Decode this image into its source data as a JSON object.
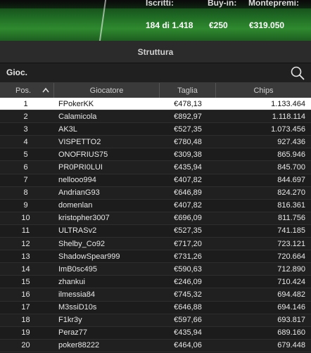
{
  "stats": {
    "iscritti_label": "Iscritti:",
    "buyin_label": "Buy-in:",
    "montepremi_label": "Montepremi:",
    "iscritti_value": "184 di 1.418",
    "buyin_value": "€250",
    "montepremi_value": "€319.050"
  },
  "section_title": "Struttura",
  "search": {
    "label": "Gioc.",
    "icon": "search-icon"
  },
  "table": {
    "columns": [
      "Pos.",
      "Giocatore",
      "Taglia",
      "Chips"
    ],
    "sort_icon": "chevron-up-icon",
    "rows": [
      {
        "pos": "1",
        "name": "FPokerKK",
        "taglia": "€478,13",
        "chips": "1.133.464"
      },
      {
        "pos": "2",
        "name": "Calamicola",
        "taglia": "€892,97",
        "chips": "1.118.114"
      },
      {
        "pos": "3",
        "name": "AK3L",
        "taglia": "€527,35",
        "chips": "1.073.456"
      },
      {
        "pos": "4",
        "name": "VISPETTO2",
        "taglia": "€780,48",
        "chips": "927.436"
      },
      {
        "pos": "5",
        "name": "ONOFRIUS75",
        "taglia": "€309,38",
        "chips": "865.946"
      },
      {
        "pos": "6",
        "name": "PR0PRI0LUI",
        "taglia": "€435,94",
        "chips": "845.700"
      },
      {
        "pos": "7",
        "name": "nellooo994",
        "taglia": "€407,82",
        "chips": "844.697"
      },
      {
        "pos": "8",
        "name": "AndrianG93",
        "taglia": "€646,89",
        "chips": "824.270"
      },
      {
        "pos": "9",
        "name": "domenlan",
        "taglia": "€407,82",
        "chips": "816.361"
      },
      {
        "pos": "10",
        "name": "kristopher3007",
        "taglia": "€696,09",
        "chips": "811.756"
      },
      {
        "pos": "11",
        "name": "ULTRASv2",
        "taglia": "€527,35",
        "chips": "741.185"
      },
      {
        "pos": "12",
        "name": "Shelby_Co92",
        "taglia": "€717,20",
        "chips": "723.121"
      },
      {
        "pos": "13",
        "name": "ShadowSpear999",
        "taglia": "€731,26",
        "chips": "720.664"
      },
      {
        "pos": "14",
        "name": "ImB0sc495",
        "taglia": "€590,63",
        "chips": "712.890"
      },
      {
        "pos": "15",
        "name": "zhankui",
        "taglia": "€246,09",
        "chips": "710.424"
      },
      {
        "pos": "16",
        "name": "ilmessia84",
        "taglia": "€745,32",
        "chips": "694.482"
      },
      {
        "pos": "17",
        "name": "M3ssiD10s",
        "taglia": "€646,88",
        "chips": "694.146"
      },
      {
        "pos": "18",
        "name": "F1kr3y",
        "taglia": "€597,66",
        "chips": "693.817"
      },
      {
        "pos": "19",
        "name": "Peraz77",
        "taglia": "€435,94",
        "chips": "689.160"
      },
      {
        "pos": "20",
        "name": "poker88222",
        "taglia": "€464,06",
        "chips": "679.448"
      }
    ]
  }
}
